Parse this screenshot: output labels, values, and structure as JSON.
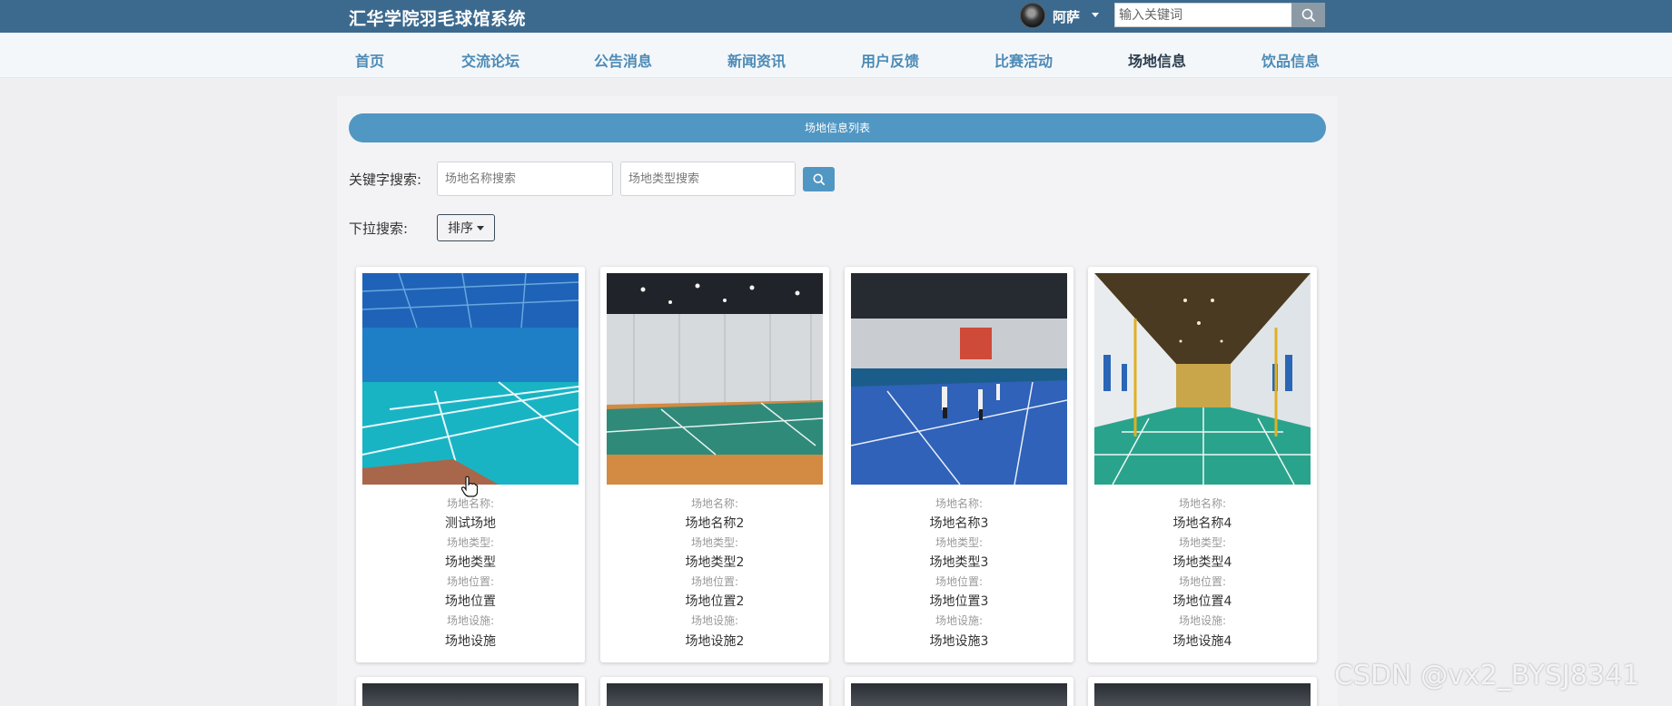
{
  "header": {
    "site_title": "汇华学院羽毛球馆系统",
    "username": "阿萨",
    "search_placeholder": "输入关键词"
  },
  "nav": [
    "首页",
    "交流论坛",
    "公告消息",
    "新闻资讯",
    "用户反馈",
    "比赛活动",
    "场地信息",
    "饮品信息"
  ],
  "nav_active": "场地信息",
  "list": {
    "title": "场地信息列表",
    "keyword_label": "关键字搜索:",
    "name_placeholder": "场地名称搜索",
    "type_placeholder": "场地类型搜索",
    "dropdown_label": "下拉搜索:",
    "sort_label": "排序"
  },
  "field_labels": {
    "name": "场地名称:",
    "type": "场地类型:",
    "location": "场地位置:",
    "facility": "场地设施:"
  },
  "venues": [
    {
      "name": "测试场地",
      "type": "场地类型",
      "location": "场地位置",
      "facility": "场地设施"
    },
    {
      "name": "场地名称2",
      "type": "场地类型2",
      "location": "场地位置2",
      "facility": "场地设施2"
    },
    {
      "name": "场地名称3",
      "type": "场地类型3",
      "location": "场地位置3",
      "facility": "场地设施3"
    },
    {
      "name": "场地名称4",
      "type": "场地类型4",
      "location": "场地位置4",
      "facility": "场地设施4"
    }
  ],
  "watermark": "CSDN @vx2_BYSJ8341",
  "colors": {
    "topbar": "#3c6a8f",
    "nav_link": "#4c8bb6",
    "accent": "#5197c3"
  }
}
